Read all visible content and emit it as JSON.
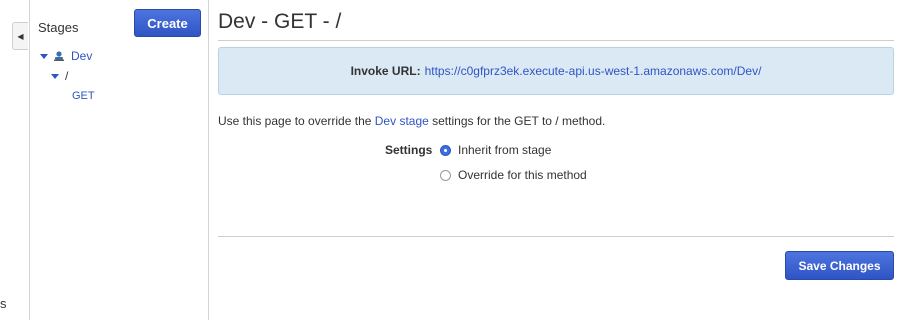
{
  "gutter": {
    "collapse_icon": "triangle-left",
    "stub_text": "s"
  },
  "sidebar": {
    "title": "Stages",
    "create_label": "Create",
    "tree": {
      "stage": {
        "name": "Dev",
        "icon": "stage-icon"
      },
      "resource": {
        "path": "/"
      },
      "method": {
        "name": "GET"
      }
    }
  },
  "main": {
    "title": "Dev - GET - /",
    "invoke": {
      "label": "Invoke URL:",
      "url": "https://c0gfprz3ek.execute-api.us-west-1.amazonaws.com/Dev/"
    },
    "description": {
      "prefix": "Use this page to override the ",
      "link": "Dev stage",
      "suffix": " settings for the GET to / method."
    },
    "settings": {
      "label": "Settings",
      "options": [
        {
          "label": "Inherit from stage",
          "selected": true
        },
        {
          "label": "Override for this method",
          "selected": false
        }
      ]
    },
    "save_label": "Save Changes"
  },
  "colors": {
    "accent": "#2f55c5",
    "info_bg": "#dbe9f4"
  }
}
